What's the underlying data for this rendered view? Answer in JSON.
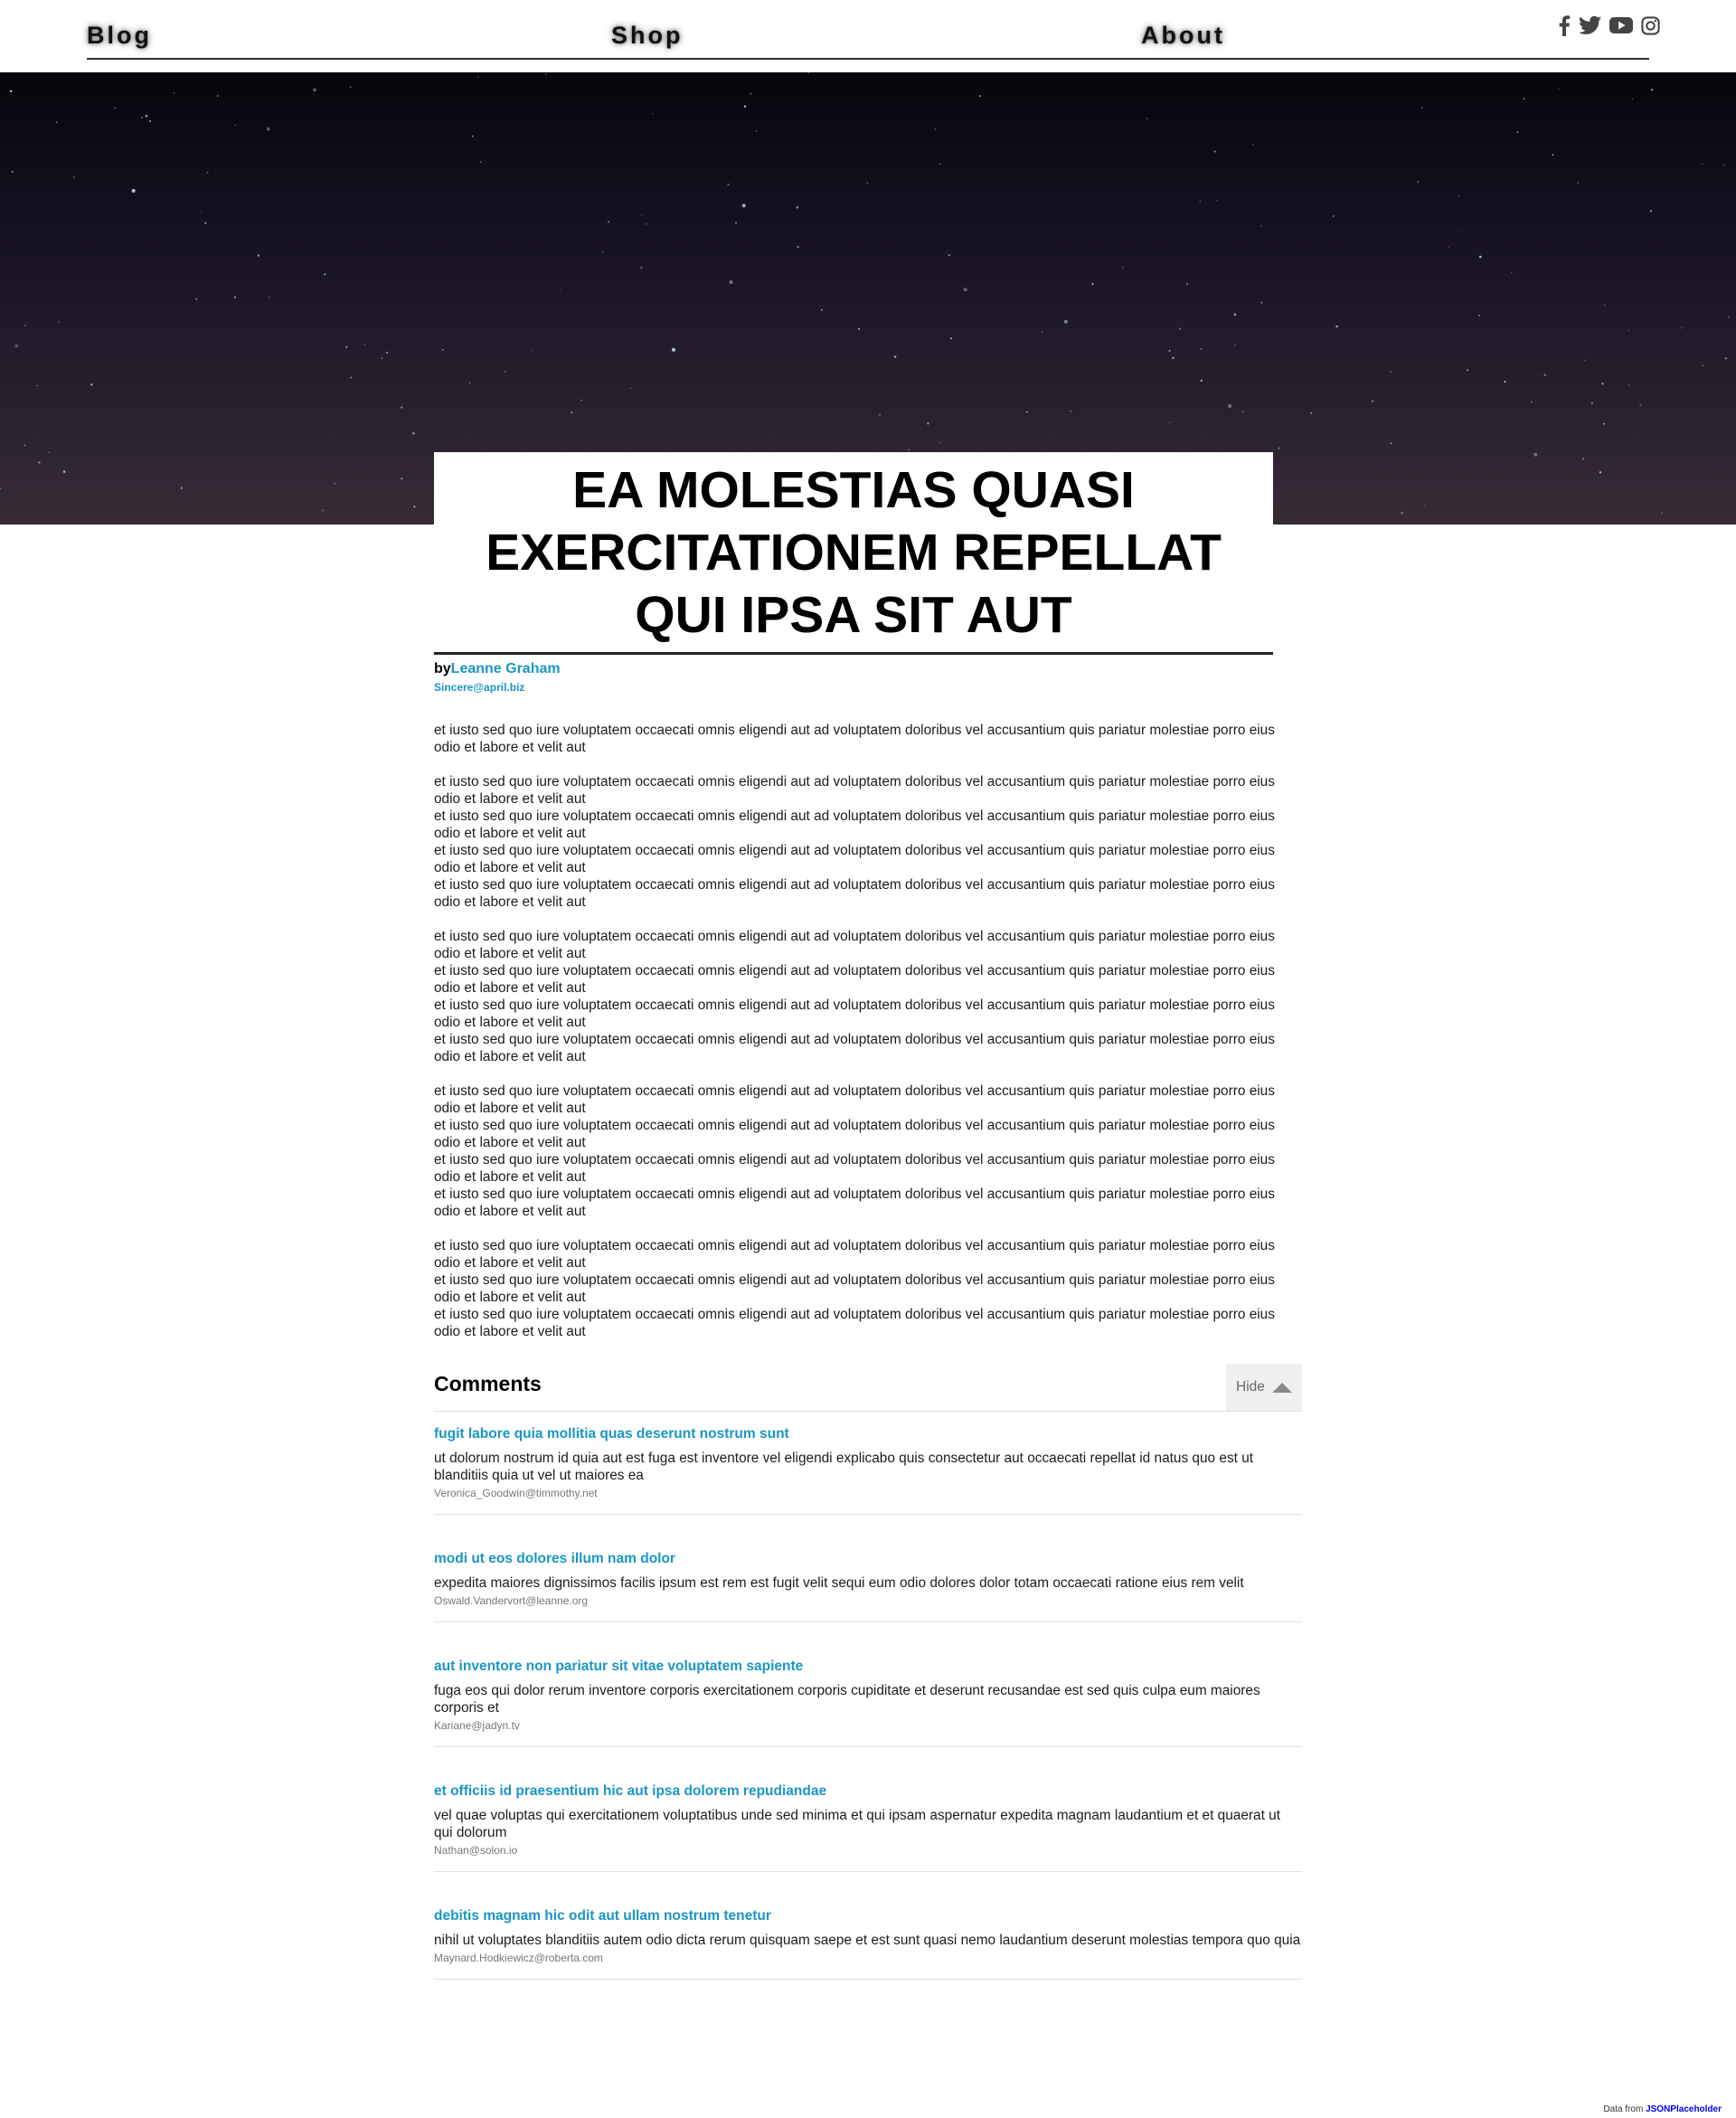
{
  "nav": {
    "links": [
      "Blog",
      "Shop",
      "About"
    ],
    "social_icons": [
      "facebook-icon",
      "twitter-icon",
      "youtube-icon",
      "instagram-icon"
    ]
  },
  "hero": {
    "style": "starry night sky"
  },
  "post": {
    "title": "ea molestias quasi exercitationem repellat qui ipsa sit aut",
    "by_label": "by",
    "author": "Leanne Graham",
    "author_email": "Sincere@april.biz",
    "body_line": "et iusto sed quo iure voluptatem occaecati omnis eligendi aut ad voluptatem doloribus vel accusantium quis pariatur molestiae porro eius odio et labore et velit aut",
    "paragraph_line_counts": [
      1,
      4,
      4,
      4,
      3
    ]
  },
  "comments": {
    "heading": "Comments",
    "toggle_label": "Hide",
    "items": [
      {
        "title": "fugit labore quia mollitia quas deserunt nostrum sunt",
        "body": "ut dolorum nostrum id quia aut est fuga est inventore vel eligendi explicabo quis consectetur aut occaecati repellat id natus quo est ut blanditiis quia ut vel ut maiores ea",
        "email": "Veronica_Goodwin@timmothy.net"
      },
      {
        "title": "modi ut eos dolores illum nam dolor",
        "body": "expedita maiores dignissimos facilis ipsum est rem est fugit velit sequi eum odio dolores dolor totam occaecati ratione eius rem velit",
        "email": "Oswald.Vandervort@leanne.org"
      },
      {
        "title": "aut inventore non pariatur sit vitae voluptatem sapiente",
        "body": "fuga eos qui dolor rerum inventore corporis exercitationem corporis cupiditate et deserunt recusandae est sed quis culpa eum maiores corporis et",
        "email": "Kariane@jadyn.tv"
      },
      {
        "title": "et officiis id praesentium hic aut ipsa dolorem repudiandae",
        "body": "vel quae voluptas qui exercitationem voluptatibus unde sed minima et qui ipsam aspernatur expedita magnam laudantium et et quaerat ut qui dolorum",
        "email": "Nathan@solon.io"
      },
      {
        "title": "debitis magnam hic odit aut ullam nostrum tenetur",
        "body": "nihil ut voluptates blanditiis autem odio dicta rerum quisquam saepe et est sunt quasi nemo laudantium deserunt molestias tempora quo quia",
        "email": "Maynard.Hodkiewicz@roberta.com"
      }
    ]
  },
  "footer": {
    "credit_prefix": "Data from",
    "credit_link": "JSONPlaceholder"
  }
}
